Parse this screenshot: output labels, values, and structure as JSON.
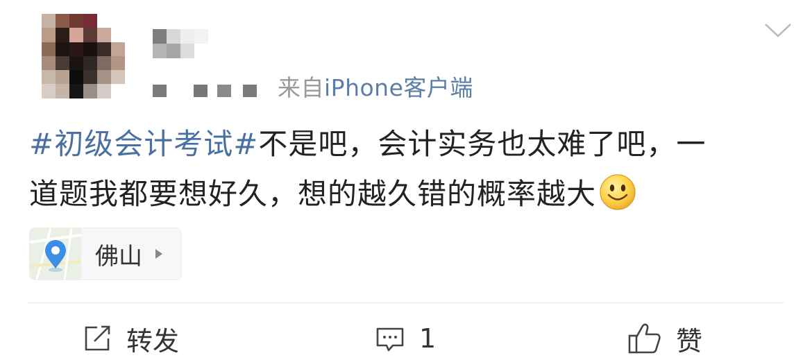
{
  "post": {
    "source_prefix": "来自",
    "source_client": "iPhone客户端",
    "topic": "#初级会计考试#",
    "text_line1": "不是吧，会计实务也太难了吧，一",
    "text_line2": "道题我都要想好久，想的越久错的概率越大",
    "emoji": "smiley-emoji"
  },
  "location": {
    "name": "佛山"
  },
  "actions": {
    "repost_label": "转发",
    "comment_count": "1",
    "like_label": "赞"
  },
  "colors": {
    "topic_link": "#4a6fa1",
    "client_link": "#5b7ea6",
    "meta_gray": "#999999"
  },
  "icons": [
    "chevron-down-icon",
    "location-pin-icon",
    "repost-icon",
    "comment-icon",
    "thumbs-up-icon",
    "smiley-emoji"
  ]
}
